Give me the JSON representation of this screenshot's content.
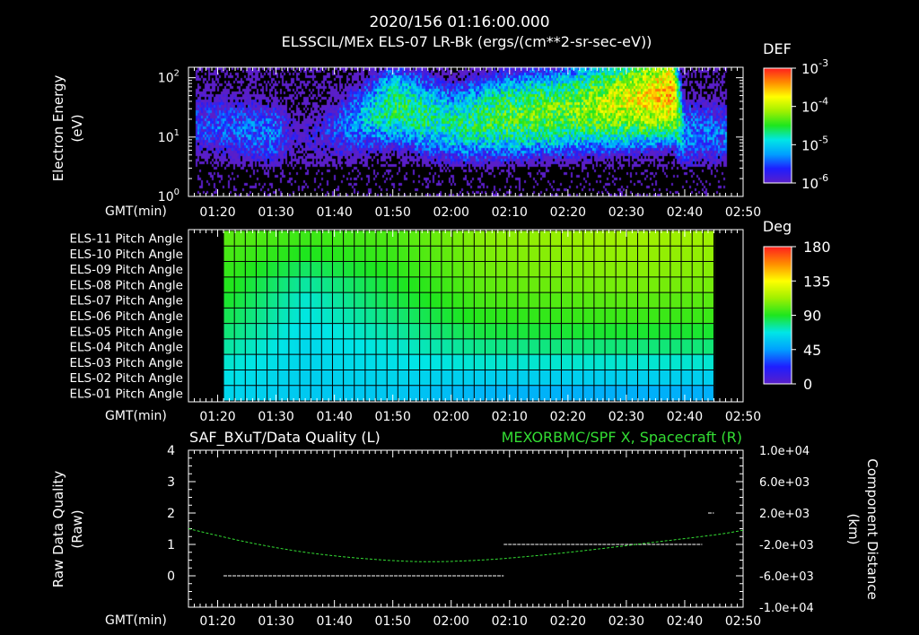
{
  "header": {
    "timestamp": "2020/156 01:16:00.000",
    "subtitle": "ELSSCIL/MEx ELS-07 LR-Bk  (ergs/(cm**2-sr-sec-eV))"
  },
  "time_axis": {
    "label": "GMT(min)",
    "ticks": [
      "01:20",
      "01:30",
      "01:40",
      "01:50",
      "02:00",
      "02:10",
      "02:20",
      "02:30",
      "02:40",
      "02:50"
    ]
  },
  "colors": {
    "background": "#000000",
    "foreground": "#ffffff",
    "right_series": "#33dd33",
    "colormap": [
      "#5a1ec8",
      "#1e1eff",
      "#00a0ff",
      "#00e6e6",
      "#1ee61e",
      "#a0f000",
      "#ffff00",
      "#ff8c00",
      "#ff1e1e"
    ]
  },
  "chart_data": [
    {
      "type": "heatmap",
      "title": "ELSSCIL/MEx ELS-07 LR-Bk  (ergs/(cm**2-sr-sec-eV))",
      "ylabel": "Electron Energy (eV)",
      "ylabel_lines": [
        "Electron Energy",
        "(eV)"
      ],
      "yscale": "log",
      "ylim": [
        1,
        150
      ],
      "yticks": [
        {
          "base": "10",
          "exp": "0"
        },
        {
          "base": "10",
          "exp": "1"
        },
        {
          "base": "10",
          "exp": "2"
        }
      ],
      "colorbar": {
        "label": "DEF",
        "scale": "log",
        "range": [
          1e-06,
          0.001
        ],
        "ticks": [
          {
            "base": "10",
            "exp": "-3"
          },
          {
            "base": "10",
            "exp": "-4"
          },
          {
            "base": "10",
            "exp": "-5"
          },
          {
            "base": "10",
            "exp": "-6"
          }
        ]
      },
      "spectrum_band_center_eV": [
        {
          "t": "01:16",
          "eV": 15,
          "level": -5.6
        },
        {
          "t": "01:30",
          "eV": 10,
          "level": -5.4
        },
        {
          "t": "01:34",
          "eV": 8,
          "level": -6.2
        },
        {
          "t": "01:38",
          "eV": 10,
          "level": -5.8
        },
        {
          "t": "01:50",
          "eV": 30,
          "level": -4.6
        },
        {
          "t": "02:00",
          "eV": 15,
          "level": -4.8
        },
        {
          "t": "02:10",
          "eV": 20,
          "level": -4.4
        },
        {
          "t": "02:20",
          "eV": 25,
          "level": -4.3
        },
        {
          "t": "02:30",
          "eV": 35,
          "level": -3.9
        },
        {
          "t": "02:38",
          "eV": 50,
          "level": -3.5
        },
        {
          "t": "02:40",
          "eV": 10,
          "level": -5.3
        },
        {
          "t": "02:47",
          "eV": 10,
          "level": -5.5
        }
      ]
    },
    {
      "type": "heatmap",
      "title": "Pitch Angle",
      "rows": [
        "ELS-11 Pitch Angle",
        "ELS-10 Pitch Angle",
        "ELS-09 Pitch Angle",
        "ELS-08 Pitch Angle",
        "ELS-07 Pitch Angle",
        "ELS-06 Pitch Angle",
        "ELS-05 Pitch Angle",
        "ELS-04 Pitch Angle",
        "ELS-03 Pitch Angle",
        "ELS-02 Pitch Angle",
        "ELS-01 Pitch Angle"
      ],
      "time_range": [
        "01:21",
        "02:45"
      ],
      "colorbar": {
        "label": "Deg",
        "range": [
          0,
          180
        ],
        "ticks": [
          "180",
          "135",
          "90",
          "45",
          "0"
        ]
      },
      "pitch_deg_by_row_at_times": {
        "times": [
          "01:22",
          "01:35",
          "01:50",
          "02:05",
          "02:25",
          "02:44"
        ],
        "values": [
          [
            100,
            95,
            98,
            108,
            112,
            112
          ],
          [
            97,
            90,
            95,
            106,
            110,
            110
          ],
          [
            94,
            82,
            92,
            104,
            108,
            108
          ],
          [
            91,
            75,
            88,
            101,
            105,
            105
          ],
          [
            88,
            70,
            85,
            97,
            100,
            100
          ],
          [
            84,
            68,
            80,
            92,
            95,
            95
          ],
          [
            80,
            65,
            75,
            86,
            88,
            88
          ],
          [
            75,
            63,
            70,
            78,
            80,
            80
          ],
          [
            70,
            62,
            66,
            70,
            70,
            70
          ],
          [
            66,
            60,
            62,
            60,
            60,
            60
          ],
          [
            62,
            58,
            58,
            52,
            50,
            50
          ]
        ]
      }
    },
    {
      "type": "line",
      "title_left": "SAF_BXuT/Data Quality (L)",
      "title_right": "MEXORBMC/SPF X, Spacecraft (R)",
      "ylabel_left": "Raw Data Quality (Raw)",
      "ylabel_left_lines": [
        "Raw Data Quality",
        "(Raw)"
      ],
      "ylabel_right": "Component Distance (km)",
      "ylabel_right_lines": [
        "Component Distance",
        "(km)"
      ],
      "ylim_left": [
        -1,
        4
      ],
      "yticks_left": [
        "4",
        "3",
        "2",
        "1",
        "0"
      ],
      "ylim_right": [
        -10000,
        10000
      ],
      "yticks_right": [
        "1.0e+04",
        "6.0e+03",
        "2.0e+03",
        "-2.0e+03",
        "-6.0e+03",
        "-1.0e+04"
      ],
      "series": [
        {
          "name": "SAF_BXuT/Data Quality",
          "axis": "left",
          "segments": [
            {
              "t0": "01:21",
              "t1": "02:09",
              "value": 0
            },
            {
              "t0": "02:09",
              "t1": "02:43",
              "value": 1
            },
            {
              "t0": "02:44",
              "t1": "02:45",
              "value": 2
            }
          ]
        },
        {
          "name": "MEXORBMC/SPF X, Spacecraft",
          "axis": "right",
          "points": [
            {
              "t": "01:15",
              "km": 0
            },
            {
              "t": "01:25",
              "km": -1700
            },
            {
              "t": "01:35",
              "km": -3000
            },
            {
              "t": "01:45",
              "km": -3800
            },
            {
              "t": "01:55",
              "km": -4200
            },
            {
              "t": "02:05",
              "km": -4000
            },
            {
              "t": "02:15",
              "km": -3400
            },
            {
              "t": "02:25",
              "km": -2600
            },
            {
              "t": "02:35",
              "km": -1700
            },
            {
              "t": "02:45",
              "km": -800
            },
            {
              "t": "02:50",
              "km": -200
            }
          ]
        }
      ]
    }
  ]
}
